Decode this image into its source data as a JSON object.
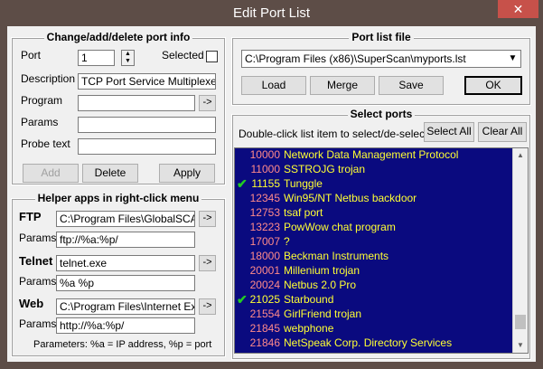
{
  "window": {
    "title": "Edit Port List",
    "close_icon": "✕"
  },
  "change_group": {
    "title": "Change/add/delete port info",
    "port_label": "Port",
    "port_value": "1",
    "selected_label": "Selected",
    "description_label": "Description",
    "description_value": "TCP Port Service Multiplexer",
    "program_label": "Program",
    "program_value": "",
    "browse_label": "->",
    "params_label": "Params",
    "params_value": "",
    "probe_label": "Probe text",
    "probe_value": "",
    "add_label": "Add",
    "delete_label": "Delete",
    "apply_label": "Apply"
  },
  "helper_group": {
    "title": "Helper apps in right-click menu",
    "ftp_label": "FTP",
    "ftp_value": "C:\\Program Files\\GlobalSCAPE",
    "ftp_params_label": "Params",
    "ftp_params_value": "ftp://%a:%p/",
    "telnet_label": "Telnet",
    "telnet_value": "telnet.exe",
    "telnet_params_label": "Params",
    "telnet_params_value": "%a %p",
    "web_label": "Web",
    "web_value": "C:\\Program Files\\Internet Explc",
    "web_params_label": "Params",
    "web_params_value": "http://%a:%p/",
    "browse_label": "->",
    "footer": "Parameters: %a = IP address, %p = port"
  },
  "portfile_group": {
    "title": "Port list file",
    "file_value": "C:\\Program Files (x86)\\SuperScan\\myports.lst",
    "load_label": "Load",
    "merge_label": "Merge",
    "save_label": "Save",
    "ok_label": "OK"
  },
  "select_group": {
    "title": "Select ports",
    "hint": "Double-click list item to select/de-select",
    "select_all_label": "Select All",
    "clear_all_label": "Clear All",
    "check_icon": "✔",
    "rows": [
      {
        "port": "10000",
        "desc": "Network Data Management Protocol",
        "checked": false
      },
      {
        "port": "11000",
        "desc": "SSTROJG trojan",
        "checked": false
      },
      {
        "port": "11155",
        "desc": "Tunggle",
        "checked": true
      },
      {
        "port": "12345",
        "desc": "Win95/NT Netbus backdoor",
        "checked": false
      },
      {
        "port": "12753",
        "desc": "tsaf port",
        "checked": false
      },
      {
        "port": "13223",
        "desc": "PowWow chat program",
        "checked": false
      },
      {
        "port": "17007",
        "desc": "?",
        "checked": false
      },
      {
        "port": "18000",
        "desc": "Beckman Instruments",
        "checked": false
      },
      {
        "port": "20001",
        "desc": "Millenium trojan",
        "checked": false
      },
      {
        "port": "20024",
        "desc": "Netbus 2.0 Pro",
        "checked": false
      },
      {
        "port": "21025",
        "desc": "Starbound",
        "checked": true
      },
      {
        "port": "21554",
        "desc": "GirlFriend trojan",
        "checked": false
      },
      {
        "port": "21845",
        "desc": "webphone",
        "checked": false
      },
      {
        "port": "21846",
        "desc": "NetSpeak Corp. Directory Services",
        "checked": false
      }
    ]
  }
}
